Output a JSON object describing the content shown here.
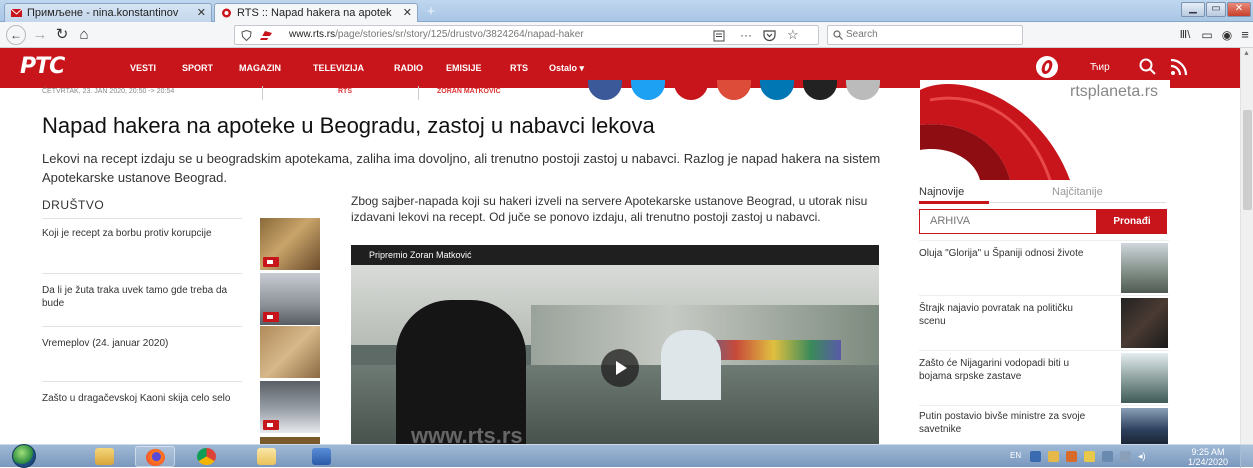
{
  "browser": {
    "tabs": [
      {
        "title": "Примљене - nina.konstantinov",
        "active": false
      },
      {
        "title": "RTS :: Napad hakera na apotek",
        "active": true
      }
    ],
    "new_tab_symbol": "+",
    "url_host": "www.rts.rs",
    "url_path": "/page/stories/sr/story/125/drustvo/3824264/napad-haker",
    "search_placeholder": "Search",
    "more_symbol": "···"
  },
  "site": {
    "logo": "РТС",
    "menu": [
      "VESTI",
      "SPORT",
      "MAGAZIN",
      "TELEVIZIJA",
      "RADIO",
      "EMISIJE",
      "RTS",
      "Ostalo"
    ],
    "script_toggle": "Ћир"
  },
  "article": {
    "dateline": "ČETVRTAK, 23. JAN 2020, 20:50 -> 20:54",
    "meta_links": [
      "RTS",
      "ZORAN MATKOVIĆ"
    ],
    "headline": "Napad hakera na apoteke u Beogradu, zastoj u nabavci lekova",
    "lead": "Lekovi na recept izdaju se u beogradskim apotekama, zaliha ima dovoljno, ali trenutno postoji zastoj u nabavci. Razlog je napad hakera na sistem Apotekarske ustanove Beograd.",
    "body": "Zbog sajber-napada koji su hakeri izveli na servere Apotekarske ustanove Beograd, u utorak nisu izdavani lekovi na recept. Od juče se ponovo izdaju, ali trenutno postoji zastoj u nabavci.",
    "video_caption": "Pripremio Zoran Matković",
    "video_watermark": "www.rts.rs"
  },
  "related": {
    "section": "DRUŠTVO",
    "items": [
      {
        "title": "Koji je recept za borbu protiv korupcije",
        "video": true
      },
      {
        "title": "Da li je žuta traka uvek tamo gde treba da bude",
        "video": true
      },
      {
        "title": "Vremeplov (24. januar 2020)",
        "video": false
      },
      {
        "title": "Zašto u dragačevskoj Kaoni skija celo selo",
        "video": true
      }
    ]
  },
  "sidebar": {
    "ad_text": "rtsplaneta.rs",
    "tabs": [
      "Najnovije",
      "Najčitanije"
    ],
    "archive_placeholder": "ARHIVA",
    "find_button": "Pronađi",
    "items": [
      {
        "title": "Oluja \"Glorija\" u Španiji odnosi živote"
      },
      {
        "title": "Štrajk najavio povratak na političku scenu"
      },
      {
        "title": "Zašto će Nijagarini vodopadi biti u bojama srpske zastave"
      },
      {
        "title": "Putin postavio bivše ministre za svoje savetnike"
      }
    ]
  },
  "taskbar": {
    "tray_language": "EN",
    "clock_time": "9:25 AM",
    "clock_date": "1/24/2020"
  },
  "colors": {
    "rts_red": "#c8141b",
    "browser_chrome": "#f5f6f8",
    "taskbar": "#8aa7c9"
  }
}
